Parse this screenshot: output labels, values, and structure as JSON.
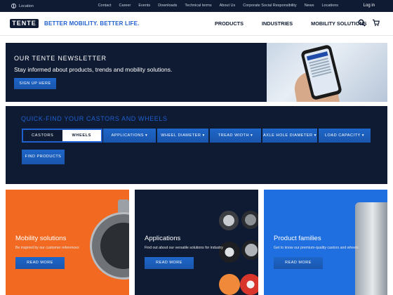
{
  "topbar": {
    "location": "Location",
    "links": [
      "Contact",
      "Career",
      "Events",
      "Downloads",
      "Technical terms",
      "About Us",
      "Corporate Social Responsibility",
      "News",
      "Locations"
    ],
    "login": "Log in"
  },
  "header": {
    "logo": "TENTE",
    "tagline": "BETTER MOBILITY. BETTER LIFE.",
    "nav": [
      "PRODUCTS",
      "INDUSTRIES",
      "MOBILITY SOLUTIONS"
    ]
  },
  "newsletter": {
    "title": "OUR TENTE NEWSLETTER",
    "subtitle": "Stay informed about products, trends and mobility solutions.",
    "button": "SIGN UP HERE"
  },
  "quickfind": {
    "title": "QUICK-FIND YOUR CASTORS AND WHEELS",
    "toggle": {
      "castors": "CASTORS",
      "wheels": "WHEELS"
    },
    "filters": [
      "APPLICATIONS",
      "WHEEL DIAMETER",
      "TREAD WIDTH",
      "AXLE HOLE DIAMETER",
      "LOAD CAPACITY"
    ],
    "button": "FIND PRODUCTS"
  },
  "cards": [
    {
      "title": "Mobility solutions",
      "subtitle": "Be inspired by our customer references",
      "button": "READ MORE"
    },
    {
      "title": "Applications",
      "subtitle": "Find out about our versatile solutions for industry",
      "button": "READ MORE"
    },
    {
      "title": "Product families",
      "subtitle": "Get to know our premium-quality castors and wheels",
      "button": "READ MORE"
    }
  ],
  "colors": {
    "navy": "#0f1b33",
    "blue": "#1f5fd0",
    "orange": "#f26a21",
    "bright_blue": "#1f6fe0"
  },
  "icons": {
    "search": "search-icon",
    "cart": "cart-icon",
    "location": "globe-icon"
  }
}
